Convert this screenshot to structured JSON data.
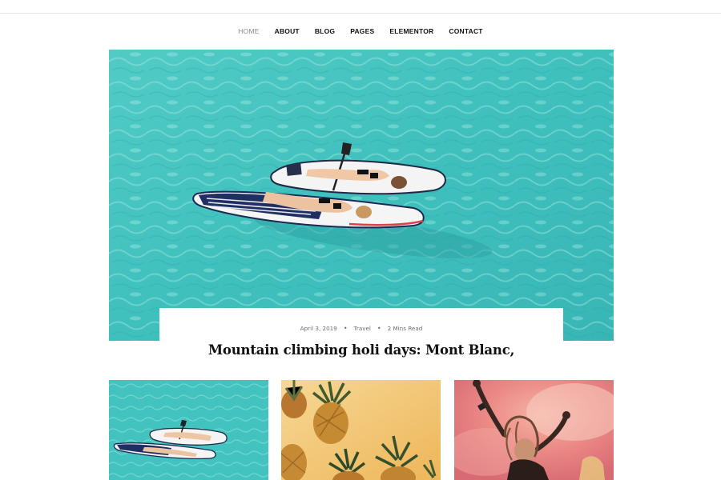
{
  "nav": {
    "items": [
      {
        "label": "HOME",
        "active": true
      },
      {
        "label": "ABOUT",
        "active": false
      },
      {
        "label": "BLOG",
        "active": false
      },
      {
        "label": "PAGES",
        "active": false
      },
      {
        "label": "ELEMENTOR",
        "active": false
      },
      {
        "label": "CONTACT",
        "active": false
      }
    ]
  },
  "featured_post": {
    "date": "April 3, 2019",
    "category": "Travel",
    "read_time": "2 Mins Read",
    "separator": "•",
    "title": "Mountain climbing holi days: Mont Blanc,",
    "image": "paddleboards-turquoise-water"
  },
  "cards": [
    {
      "image": "paddleboards-turquoise-water"
    },
    {
      "image": "pineapples-yellow-background"
    },
    {
      "image": "dancing-woman-colored-smoke"
    }
  ],
  "colors": {
    "water": "#3fc3c0",
    "water_light": "#8fe3db",
    "pineapple_bg": "#f3c87a",
    "smoke": "#e8807c",
    "nav_active": "#8a8a8a",
    "text": "#111111"
  }
}
